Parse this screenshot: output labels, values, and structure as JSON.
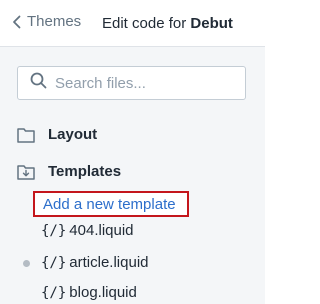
{
  "header": {
    "back_label": "Themes",
    "title_prefix": "Edit code for",
    "theme_name": "Debut"
  },
  "search": {
    "placeholder": "Search files...",
    "value": ""
  },
  "folders": [
    {
      "label": "Layout",
      "icon": "folder-icon"
    },
    {
      "label": "Templates",
      "icon": "folder-open-icon"
    }
  ],
  "templates": {
    "add_label": "Add a new template",
    "code_glyph": "{/}",
    "files": [
      {
        "label": "404.liquid",
        "unsaved": false
      },
      {
        "label": "article.liquid",
        "unsaved": true
      },
      {
        "label": "blog.liquid",
        "unsaved": false
      }
    ]
  },
  "colors": {
    "link": "#2c6ecb",
    "highlight_border": "#c4161c",
    "muted": "#637381",
    "unsaved_dot": "#b4bcc4"
  }
}
